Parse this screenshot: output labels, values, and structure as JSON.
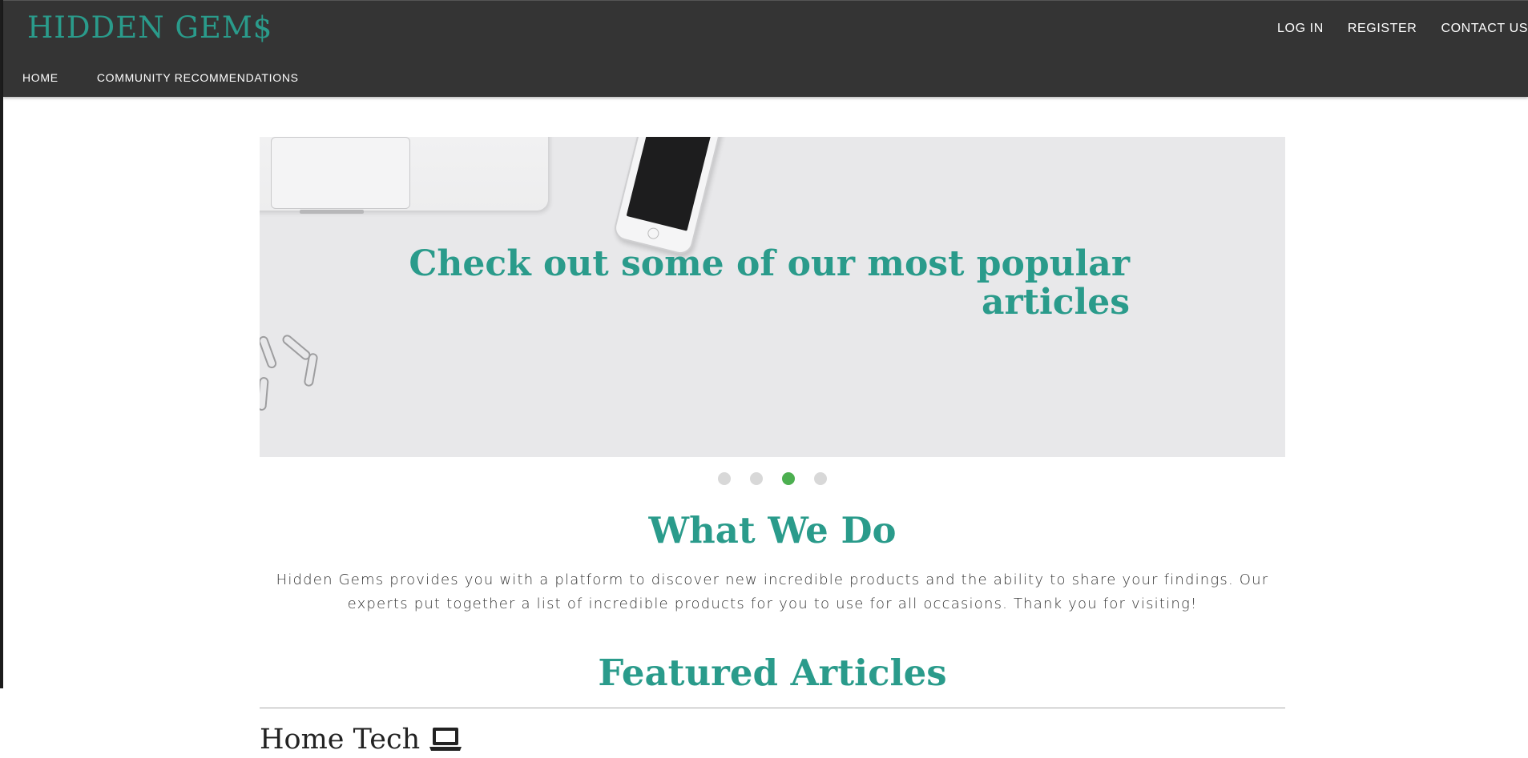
{
  "brand": {
    "name": "HIDDEN GEM$"
  },
  "top_nav": [
    "LOG IN",
    "REGISTER",
    "CONTACT US"
  ],
  "sub_nav": [
    "HOME",
    "COMMUNITY RECOMMENDATIONS"
  ],
  "hero": {
    "caption": "Check out some of our most popular articles",
    "slides_count": 4,
    "active_slide": 3
  },
  "about": {
    "title": "What We Do",
    "text": "Hidden Gems provides you with a platform to discover new incredible products and the ability to share your findings. Our experts put together a list of incredible products for you to use for all occasions. Thank you for visiting!"
  },
  "featured": {
    "title": "Featured Articles",
    "categories": [
      {
        "label": "Home Tech",
        "icon": "laptop-icon"
      }
    ]
  },
  "colors": {
    "accent": "#2a9b8b",
    "navbar": "#343434",
    "active_dot": "#4caf50"
  }
}
